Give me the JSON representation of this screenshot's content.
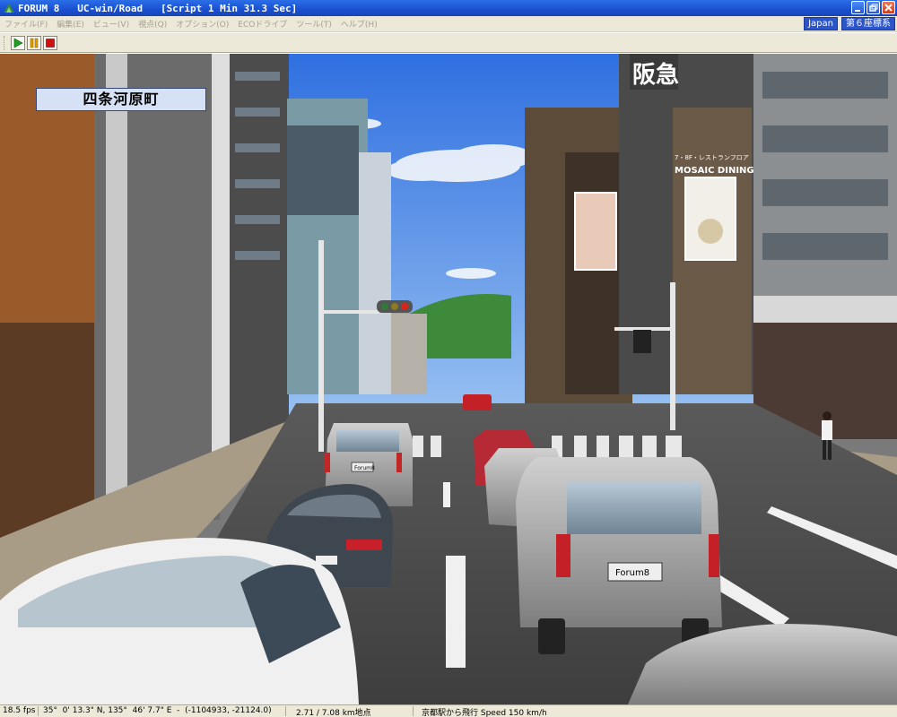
{
  "window": {
    "title": "FORUM 8   UC-win/Road   [Script 1 Min 31.3 Sec]",
    "controls": [
      "minimize",
      "restore",
      "close"
    ]
  },
  "menu": {
    "items": [
      "ファイル(F)",
      "編集(E)",
      "ビュー(V)",
      "視点(Q)",
      "オプション(O)",
      "ECOドライブ",
      "ツール(T)",
      "ヘルプ(H)"
    ],
    "region_label": "Japan",
    "coordinate_system": "第６座標系"
  },
  "toolbar": {
    "buttons": [
      {
        "name": "play",
        "icon": "play-icon",
        "color": "#1ea020"
      },
      {
        "name": "pause",
        "icon": "pause-icon",
        "color": "#e0a000"
      },
      {
        "name": "stop",
        "icon": "stop-icon",
        "color": "#d01010"
      }
    ]
  },
  "scene": {
    "location_label": "四条河原町",
    "billboards": {
      "hankyu_sign": "阪急",
      "dining_sign_small": "7・8F・レストランフロア",
      "dining_sign": "MOSAIC DINING"
    },
    "license_plate": "Forum8"
  },
  "statusbar": {
    "fps": "18.5 fps",
    "coordinates": "35°  0' 13.3\" N, 135°  46' 7.7\" E  -  (-1104933, -21124.0)",
    "distance": "2.71 / 7.08 km地点",
    "mode": "京都駅から飛行 Speed 150 km/h"
  },
  "colors": {
    "titlebar": "#1a4fd0",
    "chrome": "#ece9d8",
    "label_bg": "#d6e1f5",
    "sky": "#3f7ee6"
  }
}
